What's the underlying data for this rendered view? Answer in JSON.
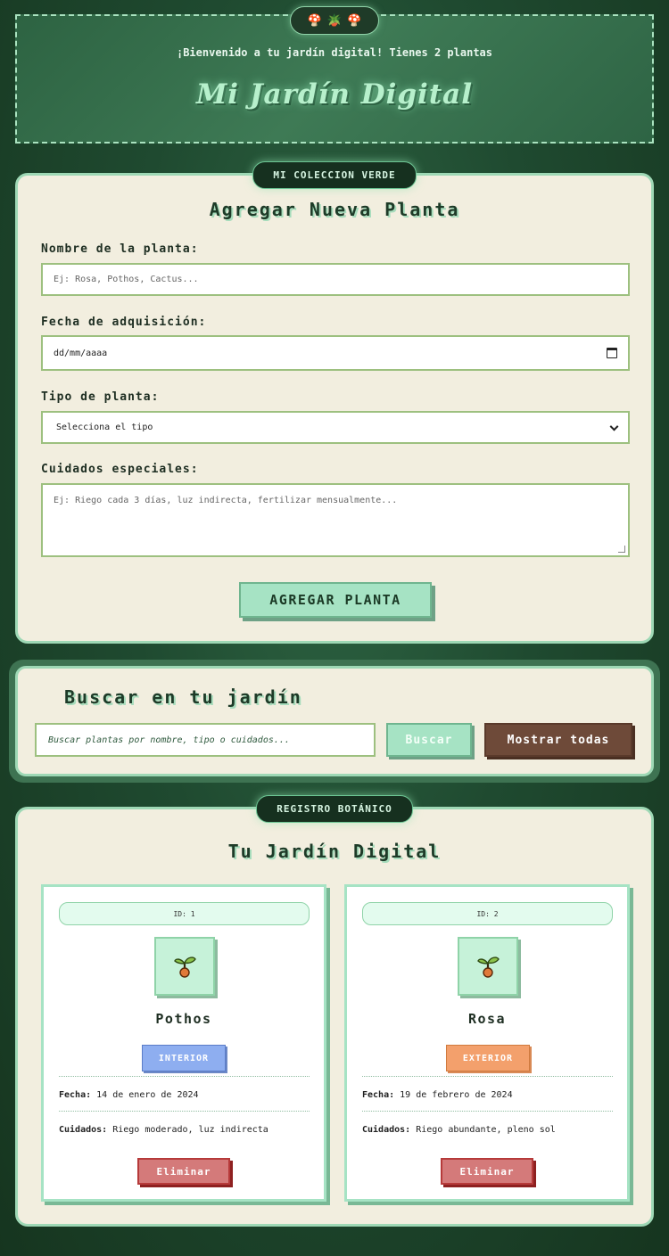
{
  "header": {
    "pill_icons": [
      "🍄",
      "🪴",
      "🍄"
    ],
    "welcome": "¡Bienvenido a tu jardín digital! Tienes 2 plantas",
    "title": "Mi Jardín Digital"
  },
  "form_card": {
    "tab_label": "MI COLECCION VERDE",
    "title": "Agregar Nueva Planta",
    "name_label": "Nombre de la planta:",
    "name_placeholder": "Ej: Rosa, Pothos, Cactus...",
    "date_label": "Fecha de adquisición:",
    "date_placeholder": "dd/mm/aaaa",
    "type_label": "Tipo de planta:",
    "type_selected": "Selecciona el tipo",
    "care_label": "Cuidados especiales:",
    "care_placeholder": "Ej: Riego cada 3 días, luz indirecta, fertilizar mensualmente...",
    "submit_label": "AGREGAR PLANTA"
  },
  "search": {
    "title": "Buscar en tu jardín",
    "placeholder": "Buscar plantas por nombre, tipo o cuidados...",
    "search_label": "Buscar",
    "show_all_label": "Mostrar todas"
  },
  "garden": {
    "tab_label": "REGISTRO BOTÁNICO",
    "title": "Tu Jardín Digital",
    "plants": [
      {
        "id_text": "ID: 1",
        "icon": "sprout-icon",
        "name": "Pothos",
        "type": "INTERIOR",
        "type_color": "#8eaef0",
        "date_label": "Fecha:",
        "date": "14 de enero de 2024",
        "care_label": "Cuidados:",
        "care": "Riego moderado, luz indirecta",
        "delete_label": "Eliminar"
      },
      {
        "id_text": "ID: 2",
        "icon": "sprout-icon",
        "name": "Rosa",
        "type": "EXTERIOR",
        "type_color": "#f3a06c",
        "date_label": "Fecha:",
        "date": "19 de febrero de 2024",
        "care_label": "Cuidados:",
        "care": "Riego abundante, pleno sol",
        "delete_label": "Eliminar"
      }
    ]
  },
  "colors": {
    "background": "#1f4a30",
    "card": "#f2eedf",
    "accent_mint": "#a6e3c4",
    "brown": "#6e4a39",
    "danger": "#d47a7a"
  }
}
